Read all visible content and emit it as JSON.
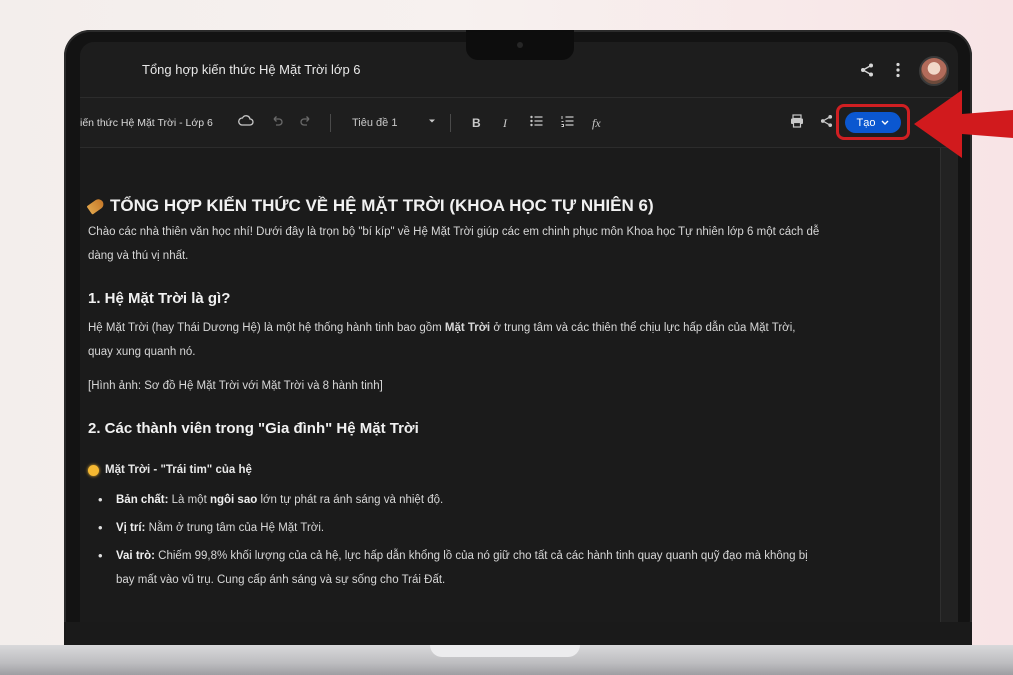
{
  "window": {
    "title": "Tổng hợp kiến thức Hệ Mặt Trời lớp 6"
  },
  "toolbar": {
    "doc_name": "iến thức Hệ Mặt Trời - Lớp 6",
    "style_select": "Tiêu đề 1",
    "bold": "B",
    "italic": "I",
    "formula": "fx",
    "create_button": "Tạo"
  },
  "document": {
    "heading": "TỔNG HỢP KIẾN THỨC VỀ HỆ MẶT TRỜI (KHOA HỌC TỰ NHIÊN 6)",
    "intro_line1": "Chào các nhà thiên văn học nhí! Dưới đây là trọn bộ \"bí kíp\" về Hệ Mặt Trời giúp các em chinh phục môn Khoa học Tự nhiên lớp 6 một cách dễ",
    "intro_line2": "dàng và thú vị nhất.",
    "section1_title": "1. Hệ Mặt Trời là gì?",
    "section1_p_a": "Hệ Mặt Trời (hay Thái Dương Hệ) là một hệ thống hành tinh bao gồm ",
    "section1_p_bold": "Mặt Trời",
    "section1_p_b": " ở trung tâm và các thiên thể chịu lực hấp dẫn của Mặt Trời,",
    "section1_p_line2": "quay xung quanh nó.",
    "image_placeholder": "[Hình ảnh: Sơ đồ Hệ Mặt Trời với Mặt Trời và 8 hành tinh]",
    "section2_title": "2. Các thành viên trong \"Gia đình\" Hệ Mặt Trời",
    "sub_title": "Mặt Trời - \"Trái tim\" của hệ",
    "bullets": {
      "b1_label": "Bản chất:",
      "b1_a": " Là một ",
      "b1_bold": "ngôi sao",
      "b1_b": " lớn tự phát ra ánh sáng và nhiệt độ.",
      "b2_label": "Vị trí:",
      "b2_text": " Nằm ở trung tâm của Hệ Mặt Trời.",
      "b3_label": "Vai trò:",
      "b3_line1": " Chiếm 99,8% khối lượng của cả hệ, lực hấp dẫn khổng lồ của nó giữ cho tất cả các hành tinh quay quanh quỹ đạo mà không bị",
      "b3_line2": "bay mất vào vũ trụ. Cung cấp ánh sáng và sự sống cho Trái Đất."
    }
  },
  "icons": [
    "share-icon",
    "more-vert-icon",
    "cloud-icon",
    "undo-icon",
    "redo-icon",
    "bulleted-list-icon",
    "numbered-list-icon",
    "print-icon",
    "chevron-down-icon",
    "rocket-icon",
    "sun-icon",
    "arrow-icon"
  ],
  "colors": {
    "accent": "#0b57d0",
    "highlight": "#d01f22",
    "background": "#1b1b1b"
  }
}
